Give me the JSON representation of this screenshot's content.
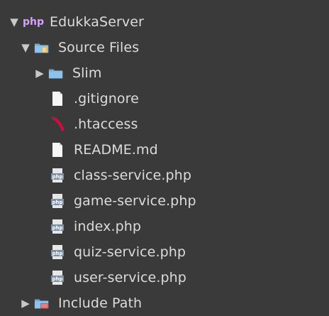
{
  "project": {
    "name": "EdukkaServer",
    "badge": "php",
    "expanded": true
  },
  "tree": {
    "source_files": {
      "label": "Source Files",
      "expanded": true
    },
    "slim": {
      "label": "Slim",
      "expanded": false
    },
    "files": [
      {
        "label": ".gitignore",
        "icon": "file-icon"
      },
      {
        "label": ".htaccess",
        "icon": "htaccess-icon"
      },
      {
        "label": "README.md",
        "icon": "file-icon"
      },
      {
        "label": "class-service.php",
        "icon": "php-file-icon"
      },
      {
        "label": "game-service.php",
        "icon": "php-file-icon"
      },
      {
        "label": "index.php",
        "icon": "php-file-icon"
      },
      {
        "label": "quiz-service.php",
        "icon": "php-file-icon"
      },
      {
        "label": "user-service.php",
        "icon": "php-file-icon"
      }
    ],
    "include_path": {
      "label": "Include Path",
      "expanded": false
    }
  },
  "colors": {
    "background": "#3a3a3a",
    "text": "#dcdcdc",
    "folder_blue": "#73b7e8",
    "php_purple": "#d7a0ff"
  }
}
